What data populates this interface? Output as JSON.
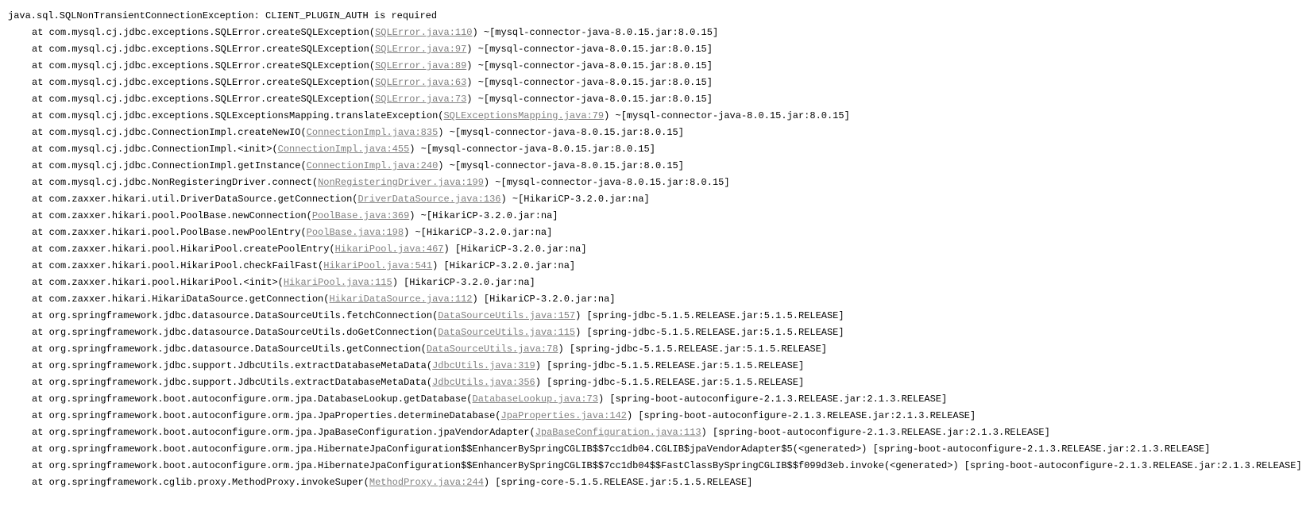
{
  "exception": "java.sql.SQLNonTransientConnectionException: CLIENT_PLUGIN_AUTH is required",
  "frames": [
    {
      "method": "at com.mysql.cj.jdbc.exceptions.SQLError.createSQLException(",
      "link": "SQLError.java:110",
      "suffix": ") ~[mysql-connector-java-8.0.15.jar:8.0.15]"
    },
    {
      "method": "at com.mysql.cj.jdbc.exceptions.SQLError.createSQLException(",
      "link": "SQLError.java:97",
      "suffix": ") ~[mysql-connector-java-8.0.15.jar:8.0.15]"
    },
    {
      "method": "at com.mysql.cj.jdbc.exceptions.SQLError.createSQLException(",
      "link": "SQLError.java:89",
      "suffix": ") ~[mysql-connector-java-8.0.15.jar:8.0.15]"
    },
    {
      "method": "at com.mysql.cj.jdbc.exceptions.SQLError.createSQLException(",
      "link": "SQLError.java:63",
      "suffix": ") ~[mysql-connector-java-8.0.15.jar:8.0.15]"
    },
    {
      "method": "at com.mysql.cj.jdbc.exceptions.SQLError.createSQLException(",
      "link": "SQLError.java:73",
      "suffix": ") ~[mysql-connector-java-8.0.15.jar:8.0.15]"
    },
    {
      "method": "at com.mysql.cj.jdbc.exceptions.SQLExceptionsMapping.translateException(",
      "link": "SQLExceptionsMapping.java:79",
      "suffix": ") ~[mysql-connector-java-8.0.15.jar:8.0.15]"
    },
    {
      "method": "at com.mysql.cj.jdbc.ConnectionImpl.createNewIO(",
      "link": "ConnectionImpl.java:835",
      "suffix": ") ~[mysql-connector-java-8.0.15.jar:8.0.15]"
    },
    {
      "method": "at com.mysql.cj.jdbc.ConnectionImpl.<init>(",
      "link": "ConnectionImpl.java:455",
      "suffix": ") ~[mysql-connector-java-8.0.15.jar:8.0.15]"
    },
    {
      "method": "at com.mysql.cj.jdbc.ConnectionImpl.getInstance(",
      "link": "ConnectionImpl.java:240",
      "suffix": ") ~[mysql-connector-java-8.0.15.jar:8.0.15]"
    },
    {
      "method": "at com.mysql.cj.jdbc.NonRegisteringDriver.connect(",
      "link": "NonRegisteringDriver.java:199",
      "suffix": ") ~[mysql-connector-java-8.0.15.jar:8.0.15]"
    },
    {
      "method": "at com.zaxxer.hikari.util.DriverDataSource.getConnection(",
      "link": "DriverDataSource.java:136",
      "suffix": ") ~[HikariCP-3.2.0.jar:na]"
    },
    {
      "method": "at com.zaxxer.hikari.pool.PoolBase.newConnection(",
      "link": "PoolBase.java:369",
      "suffix": ") ~[HikariCP-3.2.0.jar:na]"
    },
    {
      "method": "at com.zaxxer.hikari.pool.PoolBase.newPoolEntry(",
      "link": "PoolBase.java:198",
      "suffix": ") ~[HikariCP-3.2.0.jar:na]"
    },
    {
      "method": "at com.zaxxer.hikari.pool.HikariPool.createPoolEntry(",
      "link": "HikariPool.java:467",
      "suffix": ") [HikariCP-3.2.0.jar:na]"
    },
    {
      "method": "at com.zaxxer.hikari.pool.HikariPool.checkFailFast(",
      "link": "HikariPool.java:541",
      "suffix": ") [HikariCP-3.2.0.jar:na]"
    },
    {
      "method": "at com.zaxxer.hikari.pool.HikariPool.<init>(",
      "link": "HikariPool.java:115",
      "suffix": ") [HikariCP-3.2.0.jar:na]"
    },
    {
      "method": "at com.zaxxer.hikari.HikariDataSource.getConnection(",
      "link": "HikariDataSource.java:112",
      "suffix": ") [HikariCP-3.2.0.jar:na]"
    },
    {
      "method": "at org.springframework.jdbc.datasource.DataSourceUtils.fetchConnection(",
      "link": "DataSourceUtils.java:157",
      "suffix": ") [spring-jdbc-5.1.5.RELEASE.jar:5.1.5.RELEASE]"
    },
    {
      "method": "at org.springframework.jdbc.datasource.DataSourceUtils.doGetConnection(",
      "link": "DataSourceUtils.java:115",
      "suffix": ") [spring-jdbc-5.1.5.RELEASE.jar:5.1.5.RELEASE]"
    },
    {
      "method": "at org.springframework.jdbc.datasource.DataSourceUtils.getConnection(",
      "link": "DataSourceUtils.java:78",
      "suffix": ") [spring-jdbc-5.1.5.RELEASE.jar:5.1.5.RELEASE]"
    },
    {
      "method": "at org.springframework.jdbc.support.JdbcUtils.extractDatabaseMetaData(",
      "link": "JdbcUtils.java:319",
      "suffix": ") [spring-jdbc-5.1.5.RELEASE.jar:5.1.5.RELEASE]"
    },
    {
      "method": "at org.springframework.jdbc.support.JdbcUtils.extractDatabaseMetaData(",
      "link": "JdbcUtils.java:356",
      "suffix": ") [spring-jdbc-5.1.5.RELEASE.jar:5.1.5.RELEASE]"
    },
    {
      "method": "at org.springframework.boot.autoconfigure.orm.jpa.DatabaseLookup.getDatabase(",
      "link": "DatabaseLookup.java:73",
      "suffix": ") [spring-boot-autoconfigure-2.1.3.RELEASE.jar:2.1.3.RELEASE]"
    },
    {
      "method": "at org.springframework.boot.autoconfigure.orm.jpa.JpaProperties.determineDatabase(",
      "link": "JpaProperties.java:142",
      "suffix": ") [spring-boot-autoconfigure-2.1.3.RELEASE.jar:2.1.3.RELEASE]"
    },
    {
      "method": "at org.springframework.boot.autoconfigure.orm.jpa.JpaBaseConfiguration.jpaVendorAdapter(",
      "link": "JpaBaseConfiguration.java:113",
      "suffix": ") [spring-boot-autoconfigure-2.1.3.RELEASE.jar:2.1.3.RELEASE]"
    },
    {
      "method": "at org.springframework.boot.autoconfigure.orm.jpa.HibernateJpaConfiguration$$EnhancerBySpringCGLIB$$7cc1db04.CGLIB$jpaVendorAdapter$5(<generated>",
      "link": "",
      "suffix": ") [spring-boot-autoconfigure-2.1.3.RELEASE.jar:2.1.3.RELEASE]"
    },
    {
      "method": "at org.springframework.boot.autoconfigure.orm.jpa.HibernateJpaConfiguration$$EnhancerBySpringCGLIB$$7cc1db04$$FastClassBySpringCGLIB$$f099d3eb.invoke(<generated>",
      "link": "",
      "suffix": ") [spring-boot-autoconfigure-2.1.3.RELEASE.jar:2.1.3.RELEASE]"
    },
    {
      "method": "at org.springframework.cglib.proxy.MethodProxy.invokeSuper(",
      "link": "MethodProxy.java:244",
      "suffix": ") [spring-core-5.1.5.RELEASE.jar:5.1.5.RELEASE]"
    }
  ]
}
